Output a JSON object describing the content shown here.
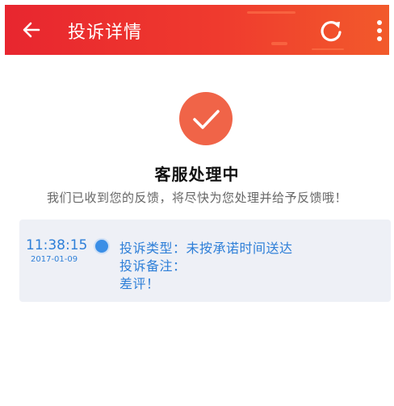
{
  "header": {
    "title": "投诉详情",
    "back_icon": "arrow-left-icon",
    "refresh_icon": "refresh-icon",
    "more_icon": "more-vertical-icon",
    "color": "#e8262f"
  },
  "status": {
    "icon": "check-icon",
    "icon_color": "#f06448",
    "title": "客服处理中",
    "description": "我们已收到您的反馈，将尽快为您处理并给予反馈哦！"
  },
  "timeline": {
    "entries": [
      {
        "time": "11:38:15",
        "date": "2017-01-09",
        "type_line": "投诉类型：未按承诺时间送达",
        "note_label": "投诉备注：",
        "note_text": "差评！",
        "color": "#2e7fd8"
      }
    ]
  }
}
